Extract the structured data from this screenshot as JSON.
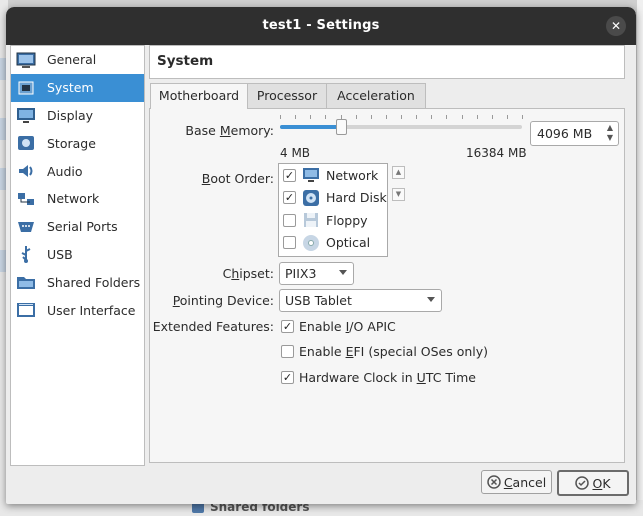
{
  "window": {
    "title": "test1 - Settings"
  },
  "sidebar": {
    "items": [
      {
        "label": "General",
        "icon": "general-icon"
      },
      {
        "label": "System",
        "icon": "system-icon",
        "active": true
      },
      {
        "label": "Display",
        "icon": "display-icon"
      },
      {
        "label": "Storage",
        "icon": "storage-icon"
      },
      {
        "label": "Audio",
        "icon": "audio-icon"
      },
      {
        "label": "Network",
        "icon": "network-icon"
      },
      {
        "label": "Serial Ports",
        "icon": "serial-ports-icon"
      },
      {
        "label": "USB",
        "icon": "usb-icon"
      },
      {
        "label": "Shared Folders",
        "icon": "shared-folders-icon"
      },
      {
        "label": "User Interface",
        "icon": "user-interface-icon"
      }
    ]
  },
  "header": {
    "title": "System"
  },
  "tabs": [
    {
      "label": "Motherboard",
      "active": true
    },
    {
      "label": "Processor"
    },
    {
      "label": "Acceleration"
    }
  ],
  "motherboard": {
    "base_memory": {
      "label_pre": "Base ",
      "label_u": "M",
      "label_post": "emory:",
      "min_label": "4 MB",
      "max_label": "16384 MB",
      "value_text": "4096 MB",
      "value": 4096,
      "min": 4,
      "max": 16384
    },
    "boot_order": {
      "label_pre": "",
      "label_u": "B",
      "label_post": "oot Order:",
      "items": [
        {
          "label": "Network",
          "checked": true
        },
        {
          "label": "Hard Disk",
          "checked": true
        },
        {
          "label": "Floppy",
          "checked": false
        },
        {
          "label": "Optical",
          "checked": false
        }
      ],
      "up_label": "▲",
      "down_label": "▼"
    },
    "chipset": {
      "label_pre": "C",
      "label_u": "h",
      "label_post": "ipset:",
      "value": "PIIX3"
    },
    "pointing": {
      "label_pre": "",
      "label_u": "P",
      "label_post": "ointing Device:",
      "value": "USB Tablet"
    },
    "extended": {
      "label": "Extended Features:",
      "items": [
        {
          "pre": "Enable ",
          "u": "I",
          "post": "/O APIC",
          "checked": true
        },
        {
          "pre": "Enable ",
          "u": "E",
          "post": "FI (special OSes only)",
          "checked": false
        },
        {
          "pre": "Hardware Clock in ",
          "u": "U",
          "post": "TC Time",
          "checked": true
        }
      ]
    }
  },
  "buttons": {
    "cancel_pre": "",
    "cancel_u": "C",
    "cancel_post": "ancel",
    "ok_pre": "",
    "ok_u": "O",
    "ok_post": "K"
  },
  "background": {
    "bottom_text": "Shared folders"
  },
  "colors": {
    "accent": "#3a8fd4",
    "titlebar": "#2f2f2f"
  }
}
